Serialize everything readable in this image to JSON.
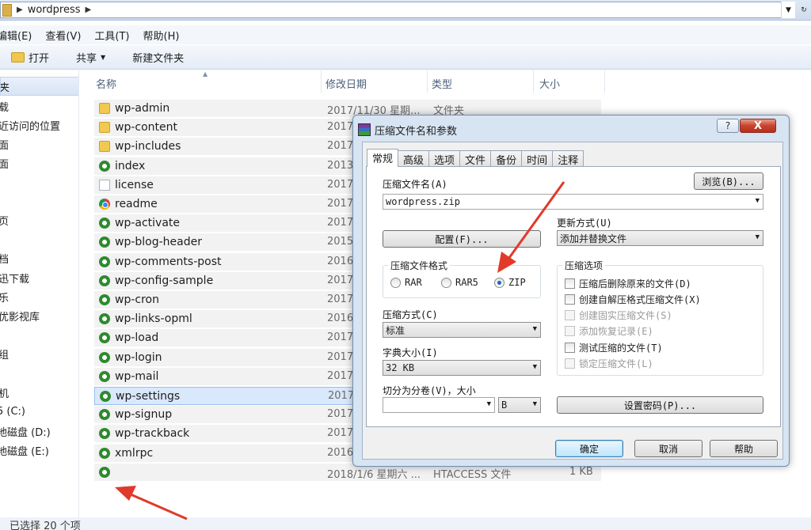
{
  "address": {
    "crumb": "wordpress"
  },
  "menu": [
    "编辑(E)",
    "查看(V)",
    "工具(T)",
    "帮助(H)"
  ],
  "toolbar": {
    "open": "打开",
    "share": "共享",
    "new_folder": "新建文件夹"
  },
  "nav": [
    "夹",
    "载",
    "近访问的位置",
    "面",
    "面",
    "",
    "",
    "页",
    "",
    "档",
    "迅下载",
    "乐",
    "优影视库",
    "",
    "组",
    "",
    "",
    "机",
    "5 (C:)",
    "地磁盘 (D:)",
    "地磁盘 (E:)"
  ],
  "columns": {
    "name": "名称",
    "date": "修改日期",
    "type": "类型",
    "size": "大小"
  },
  "files": [
    {
      "name": "wp-admin",
      "date": "2017/11/30 星期...",
      "type": "文件夹",
      "size": "",
      "icon": "folder-icon"
    },
    {
      "name": "wp-content",
      "date": "2017",
      "type": "",
      "size": "",
      "icon": "folder-icon"
    },
    {
      "name": "wp-includes",
      "date": "2017",
      "type": "",
      "size": "",
      "icon": "folder-icon"
    },
    {
      "name": "index",
      "date": "2013",
      "type": "",
      "size": "",
      "icon": "php-file-icon"
    },
    {
      "name": "license",
      "date": "2017",
      "type": "",
      "size": "",
      "icon": "text-file-icon"
    },
    {
      "name": "readme",
      "date": "2017",
      "type": "",
      "size": "",
      "icon": "chrome-file-icon"
    },
    {
      "name": "wp-activate",
      "date": "2017",
      "type": "",
      "size": "",
      "icon": "php-file-icon"
    },
    {
      "name": "wp-blog-header",
      "date": "2015",
      "type": "",
      "size": "",
      "icon": "php-file-icon"
    },
    {
      "name": "wp-comments-post",
      "date": "2016",
      "type": "",
      "size": "",
      "icon": "php-file-icon"
    },
    {
      "name": "wp-config-sample",
      "date": "2017",
      "type": "",
      "size": "",
      "icon": "php-file-icon"
    },
    {
      "name": "wp-cron",
      "date": "2017",
      "type": "",
      "size": "",
      "icon": "php-file-icon"
    },
    {
      "name": "wp-links-opml",
      "date": "2016",
      "type": "",
      "size": "",
      "icon": "php-file-icon"
    },
    {
      "name": "wp-load",
      "date": "2017",
      "type": "",
      "size": "",
      "icon": "php-file-icon"
    },
    {
      "name": "wp-login",
      "date": "2017",
      "type": "",
      "size": "",
      "icon": "php-file-icon"
    },
    {
      "name": "wp-mail",
      "date": "2017",
      "type": "",
      "size": "",
      "icon": "php-file-icon"
    },
    {
      "name": "wp-settings",
      "date": "2017",
      "type": "",
      "size": "",
      "icon": "php-file-icon",
      "selected": true
    },
    {
      "name": "wp-signup",
      "date": "2017",
      "type": "",
      "size": "",
      "icon": "php-file-icon"
    },
    {
      "name": "wp-trackback",
      "date": "2017",
      "type": "",
      "size": "",
      "icon": "php-file-icon"
    },
    {
      "name": "xmlrpc",
      "date": "2016",
      "type": "",
      "size": "",
      "icon": "php-file-icon"
    },
    {
      "name": "",
      "date": "2018/1/6 星期六 ...",
      "type": "HTACCESS 文件",
      "size": "1 KB",
      "icon": "php-file-icon"
    }
  ],
  "status": "已选择 20 个项",
  "dialog": {
    "title": "压缩文件名和参数",
    "help_btn": "?",
    "close_btn": "X",
    "tabs": [
      "常规",
      "高级",
      "选项",
      "文件",
      "备份",
      "时间",
      "注释"
    ],
    "archive_name_label": "压缩文件名(A)",
    "browse_btn": "浏览(B)...",
    "archive_name_value": "wordpress.zip",
    "update_mode_label": "更新方式(U)",
    "update_mode_value": "添加并替换文件",
    "config_btn": "配置(F)...",
    "format_group": "压缩文件格式",
    "formats": [
      "RAR",
      "RAR5",
      "ZIP"
    ],
    "selected_format": "ZIP",
    "method_label": "压缩方式(C)",
    "method_value": "标准",
    "dict_label": "字典大小(I)",
    "dict_value": "32 KB",
    "split_label": "切分为分卷(V)，大小",
    "split_value": "",
    "split_unit": "B",
    "options_group": "压缩选项",
    "options": [
      {
        "label": "压缩后删除原来的文件(D)",
        "enabled": true
      },
      {
        "label": "创建自解压格式压缩文件(X)",
        "enabled": true
      },
      {
        "label": "创建固实压缩文件(S)",
        "enabled": false
      },
      {
        "label": "添加恢复记录(E)",
        "enabled": false
      },
      {
        "label": "测试压缩的文件(T)",
        "enabled": true
      },
      {
        "label": "锁定压缩文件(L)",
        "enabled": false
      }
    ],
    "password_btn": "设置密码(P)...",
    "ok_btn": "确定",
    "cancel_btn": "取消",
    "helpbtn": "帮助"
  },
  "colors": {
    "accent_arrow": "#e03a2a",
    "selection": "#d9e8fb"
  }
}
